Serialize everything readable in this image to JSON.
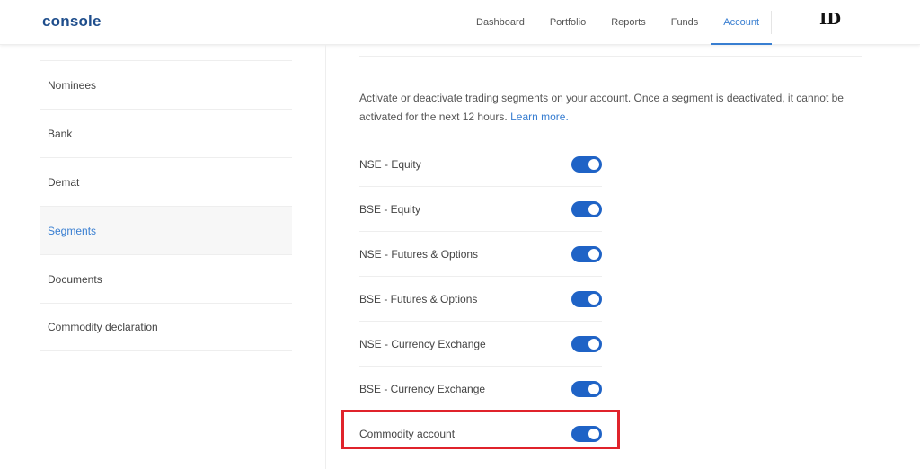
{
  "header": {
    "logo": "console",
    "nav": [
      {
        "label": "Dashboard",
        "active": false
      },
      {
        "label": "Portfolio",
        "active": false
      },
      {
        "label": "Reports",
        "active": false
      },
      {
        "label": "Funds",
        "active": false
      },
      {
        "label": "Account",
        "active": true
      }
    ],
    "user_id": "ID"
  },
  "sidebar": {
    "items": [
      {
        "label": "Nominees",
        "active": false
      },
      {
        "label": "Bank",
        "active": false
      },
      {
        "label": "Demat",
        "active": false
      },
      {
        "label": "Segments",
        "active": true
      },
      {
        "label": "Documents",
        "active": false
      },
      {
        "label": "Commodity declaration",
        "active": false
      }
    ]
  },
  "main": {
    "description": "Activate or deactivate trading segments on your account. Once a segment is deactivated, it cannot be activated for the next 12 hours.",
    "learn_more": "Learn more.",
    "segments": [
      {
        "label": "NSE - Equity",
        "enabled": true
      },
      {
        "label": "BSE - Equity",
        "enabled": true
      },
      {
        "label": "NSE - Futures & Options",
        "enabled": true
      },
      {
        "label": "BSE - Futures & Options",
        "enabled": true
      },
      {
        "label": "NSE - Currency Exchange",
        "enabled": true
      },
      {
        "label": "BSE - Currency Exchange",
        "enabled": true
      },
      {
        "label": "Commodity account",
        "enabled": true
      }
    ]
  },
  "colors": {
    "accent": "#387ed1",
    "toggle_on": "#1f63c6",
    "highlight": "#e0232b",
    "logo": "#1f4e8c"
  }
}
